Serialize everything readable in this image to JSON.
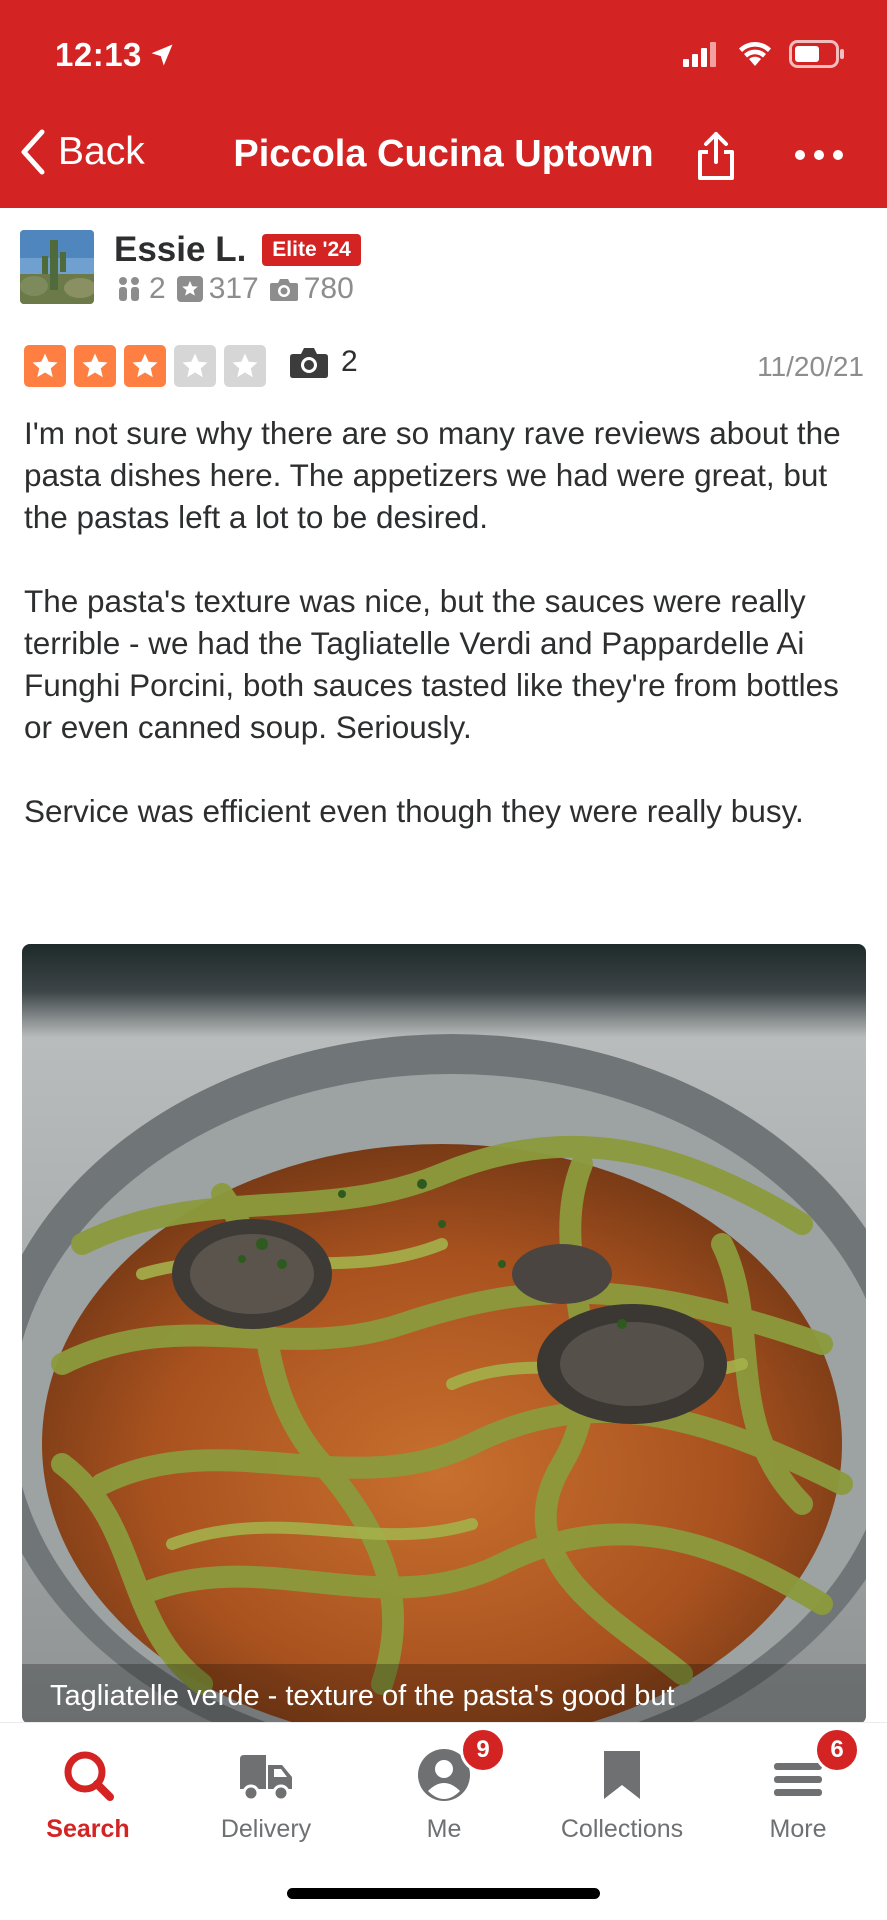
{
  "status_bar": {
    "time": "12:13"
  },
  "nav": {
    "back_label": "Back",
    "title": "Piccola Cucina Uptown"
  },
  "user": {
    "name": "Essie L.",
    "elite_badge": "Elite '24",
    "friends": "2",
    "reviews": "317",
    "photos": "780"
  },
  "review": {
    "rating": 3,
    "max_rating": 5,
    "photo_count": "2",
    "date": "11/20/21",
    "paragraphs": [
      "I'm not sure why there are so many rave reviews about the pasta dishes here. The appetizers we had were great, but the pastas left a lot to be desired.",
      "The pasta's texture was nice, but the sauces were really terrible - we had the Tagliatelle Verdi and Pappardelle Ai Funghi Porcini, both sauces tasted like they're from bottles or even canned soup. Seriously.",
      "Service was efficient even though they were really busy."
    ],
    "photo_caption": "Tagliatelle verde - texture of the pasta's good but"
  },
  "tabbar": {
    "items": [
      {
        "label": "Search",
        "icon": "search-icon",
        "active": true
      },
      {
        "label": "Delivery",
        "icon": "delivery-truck-icon"
      },
      {
        "label": "Me",
        "icon": "profile-icon",
        "badge": "9"
      },
      {
        "label": "Collections",
        "icon": "bookmark-icon"
      },
      {
        "label": "More",
        "icon": "menu-lines-icon",
        "badge": "6"
      }
    ]
  },
  "colors": {
    "brand_red": "#d32323",
    "star_orange": "#ff7e42",
    "star_empty": "#d6d6d6"
  }
}
